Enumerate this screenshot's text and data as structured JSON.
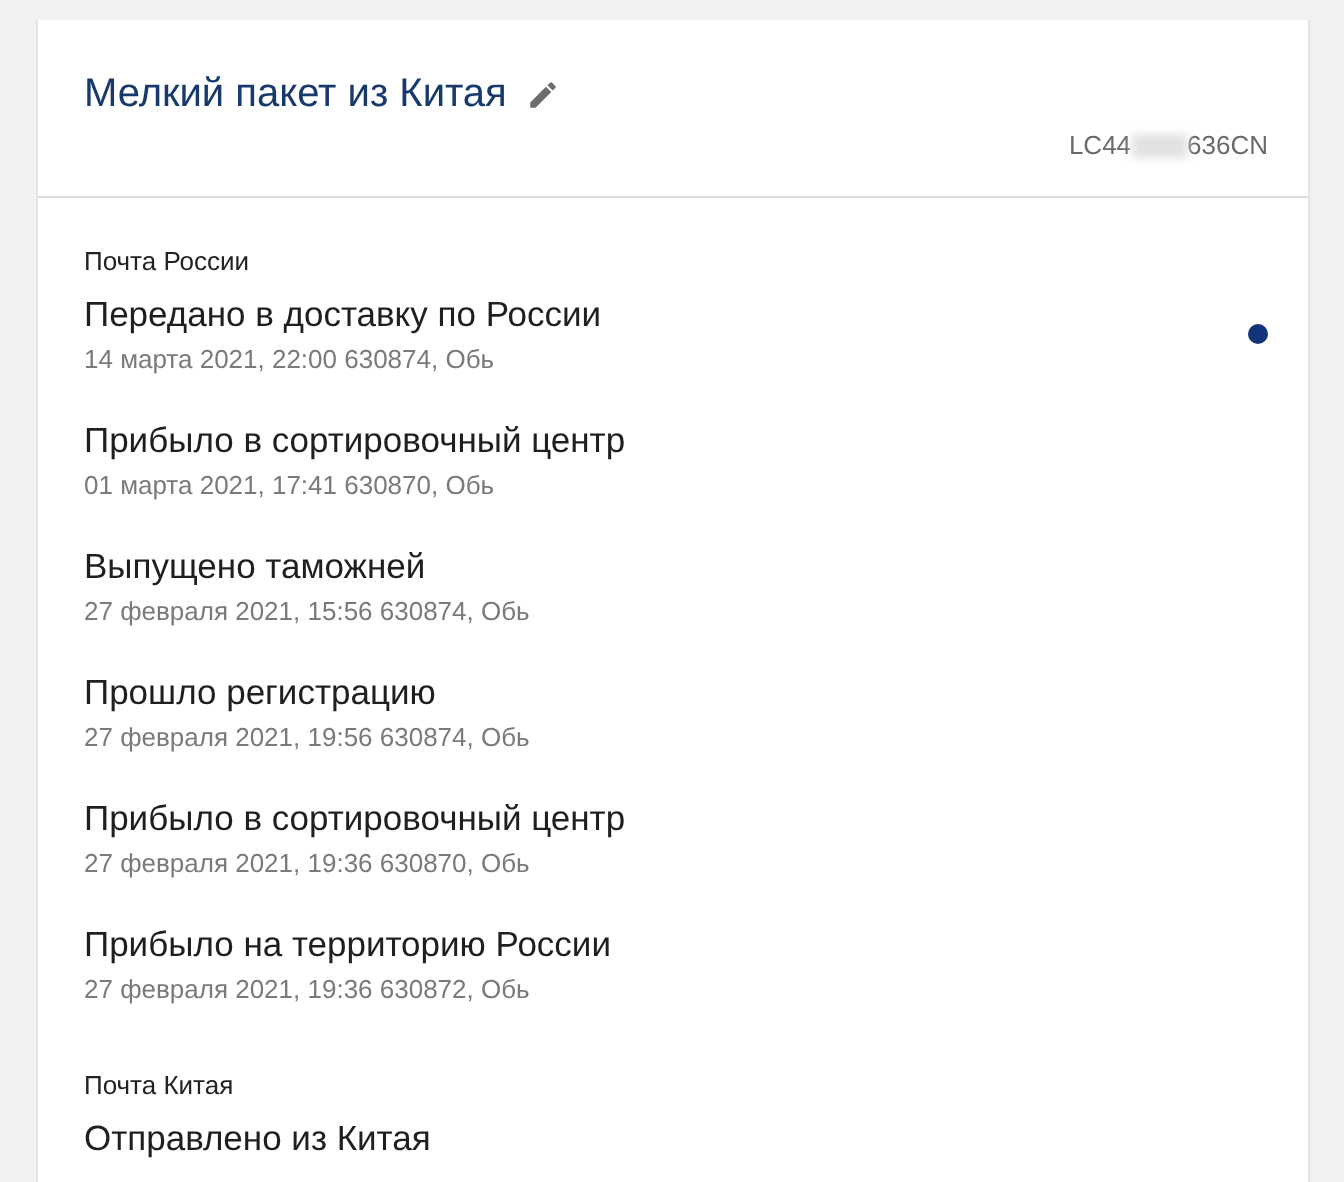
{
  "parcel": {
    "title": "Мелкий пакет из Китая",
    "tracking_start": "LC44",
    "tracking_end": "636CN"
  },
  "groups": [
    {
      "carrier": "Почта России",
      "events": [
        {
          "status": "Передано в доставку по России",
          "details": "14 марта 2021, 22:00 630874, Обь",
          "new": true
        },
        {
          "status": "Прибыло в сортировочный центр",
          "details": "01 марта 2021, 17:41 630870, Обь",
          "new": false
        },
        {
          "status": "Выпущено таможней",
          "details": "27 февраля 2021, 15:56 630874, Обь",
          "new": false
        },
        {
          "status": "Прошло регистрацию",
          "details": "27 февраля 2021, 19:56 630874, Обь",
          "new": false
        },
        {
          "status": "Прибыло в сортировочный центр",
          "details": "27 февраля 2021, 19:36 630870, Обь",
          "new": false
        },
        {
          "status": "Прибыло на территорию России",
          "details": "27 февраля 2021, 19:36 630872, Обь",
          "new": false
        }
      ]
    },
    {
      "carrier": "Почта Китая",
      "events": [
        {
          "status": "Отправлено из Китая",
          "new": false
        }
      ]
    }
  ]
}
